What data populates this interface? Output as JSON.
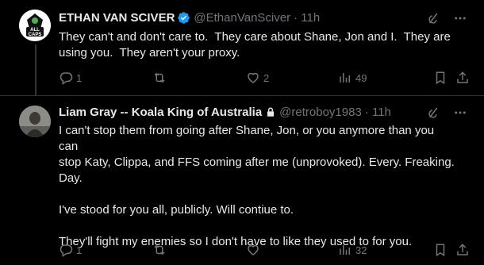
{
  "tweets": [
    {
      "display_name": "ETHAN VAN SCIVER",
      "handle": "@EthanVanSciver",
      "time": "· 11h",
      "verified": true,
      "text": "They can't and don't care to.  They care about Shane, Jon and I.  They are\nusing you.  They aren't your proxy.",
      "replies": "1",
      "retweets": "",
      "likes": "2",
      "views": "49"
    },
    {
      "display_name": "Liam Gray -- Koala King of Australia",
      "handle": "@retroboy1983",
      "time": "· 11h",
      "protected": true,
      "text": "I can't stop them from going after Shane, Jon, or you anymore than you can\nstop Katy, Clippa, and FFS coming after me (unprovoked). Every. Freaking.\nDay.\n\nI've stood for you all, publicly. Will contiue to.\n\nThey'll fight my enemies so I don't have to like they used to for you.",
      "replies": "1",
      "retweets": "",
      "likes": "",
      "views": "32"
    }
  ],
  "avatar1_text": "ALL CAPS",
  "colors": {
    "verified": "#1d9bf0",
    "muted": "#71767b",
    "text": "#e7e9ea",
    "bg": "#000000"
  }
}
